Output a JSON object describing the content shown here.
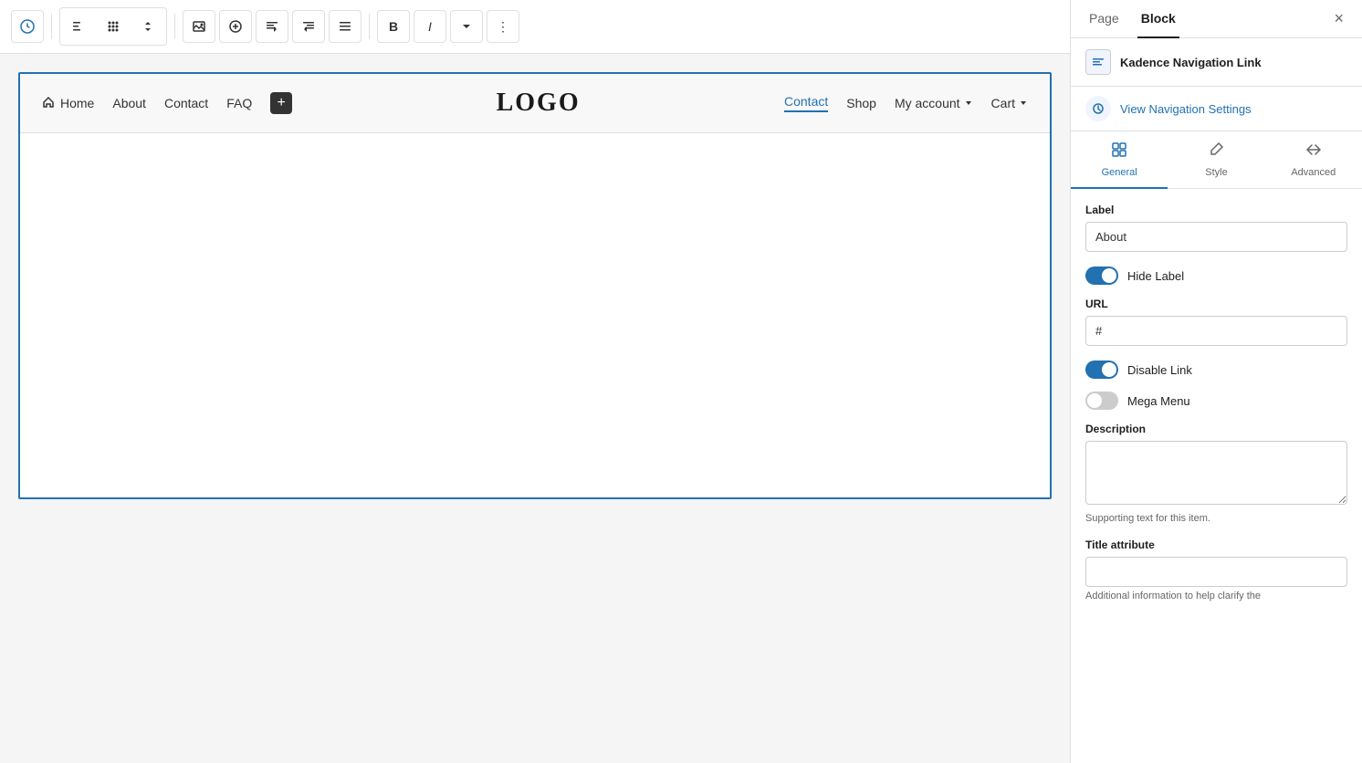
{
  "sidebar": {
    "tabs": [
      {
        "id": "page",
        "label": "Page"
      },
      {
        "id": "block",
        "label": "Block"
      }
    ],
    "active_tab": "block",
    "close_icon": "×",
    "kadence": {
      "icon_text": "≡",
      "label": "Kadence Navigation Link"
    },
    "view_navigation_settings": {
      "icon": "✎",
      "label": "View Navigation Settings"
    },
    "block_tabs": [
      {
        "id": "general",
        "label": "General",
        "icon": "⬜"
      },
      {
        "id": "style",
        "label": "Style",
        "icon": "✏"
      },
      {
        "id": "advanced",
        "label": "Advanced",
        "icon": "⇌"
      }
    ],
    "active_block_tab": "general",
    "fields": {
      "label_field": {
        "label": "Label",
        "value": "About"
      },
      "hide_label_toggle": {
        "label": "Hide Label",
        "state": "on"
      },
      "url_field": {
        "label": "URL",
        "value": "#"
      },
      "disable_link_toggle": {
        "label": "Disable Link",
        "state": "on"
      },
      "mega_menu_toggle": {
        "label": "Mega Menu",
        "state": "off"
      },
      "description_field": {
        "label": "Description",
        "value": "",
        "placeholder": ""
      },
      "description_helper": "Supporting text for this item.",
      "title_attribute_field": {
        "label": "Title attribute",
        "value": ""
      },
      "title_attribute_helper": "Additional information to help clarify the"
    }
  },
  "toolbar": {
    "buttons": [
      {
        "id": "pen",
        "icon": "✎",
        "label": "Edit"
      },
      {
        "id": "left-indent",
        "icon": "⇥",
        "label": "Left indent"
      },
      {
        "id": "grid",
        "icon": "⠿",
        "label": "Grid"
      },
      {
        "id": "arrows",
        "icon": "⇅",
        "label": "Move up/down"
      },
      {
        "id": "image",
        "icon": "⬜",
        "label": "Image"
      },
      {
        "id": "add-circle",
        "icon": "⊕",
        "label": "Add"
      },
      {
        "id": "text-left",
        "icon": "⇐",
        "label": "Text left"
      },
      {
        "id": "text-right",
        "icon": "⇒",
        "label": "Text right"
      },
      {
        "id": "align",
        "icon": "≡",
        "label": "Align"
      },
      {
        "id": "bold",
        "icon": "B",
        "label": "Bold"
      },
      {
        "id": "italic",
        "icon": "I",
        "label": "Italic"
      },
      {
        "id": "dropdown",
        "icon": "▾",
        "label": "More"
      },
      {
        "id": "more",
        "icon": "⋮",
        "label": "Options"
      }
    ]
  },
  "preview": {
    "nav_left": [
      {
        "id": "home",
        "label": "Home",
        "has_icon": true
      },
      {
        "id": "about",
        "label": "About"
      },
      {
        "id": "contact",
        "label": "Contact"
      },
      {
        "id": "faq",
        "label": "FAQ"
      }
    ],
    "logo": "LOGO",
    "nav_right": [
      {
        "id": "contact-r",
        "label": "Contact",
        "active": true
      },
      {
        "id": "shop",
        "label": "Shop",
        "active": false
      },
      {
        "id": "my-account",
        "label": "My account",
        "active": false,
        "has_dropdown": true
      },
      {
        "id": "cart",
        "label": "Cart",
        "active": false,
        "has_dropdown": true
      }
    ]
  }
}
